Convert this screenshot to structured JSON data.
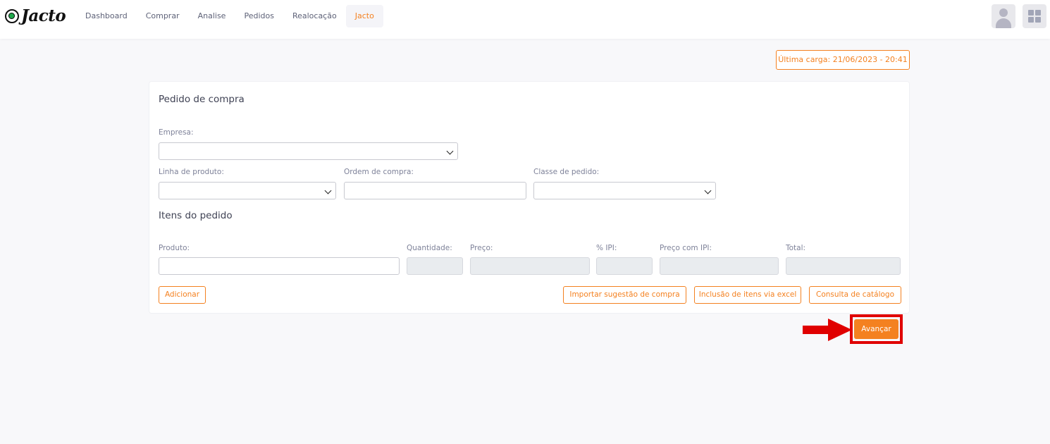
{
  "brand": {
    "name": "Jacto"
  },
  "nav": [
    {
      "label": "Dashboard",
      "active": false
    },
    {
      "label": "Comprar",
      "active": false
    },
    {
      "label": "Analise",
      "active": false
    },
    {
      "label": "Pedidos",
      "active": false
    },
    {
      "label": "Realocação",
      "active": false
    },
    {
      "label": "Jacto",
      "active": true
    }
  ],
  "header_icons": [
    "user-avatar-icon",
    "apps-grid-icon"
  ],
  "last_load": "Última carga: 21/06/2023 - 20:41",
  "order": {
    "title": "Pedido de compra",
    "empresa": {
      "label": "Empresa:",
      "value": ""
    },
    "linha_produto": {
      "label": "Linha de produto:",
      "value": ""
    },
    "ordem_compra": {
      "label": "Ordem de compra:",
      "value": ""
    },
    "classe_pedido": {
      "label": "Classe de pedido:",
      "value": ""
    }
  },
  "items": {
    "title": "Itens do pedido",
    "produto": {
      "label": "Produto:",
      "value": ""
    },
    "quantidade": {
      "label": "Quantidade:",
      "value": ""
    },
    "preco": {
      "label": "Preço:",
      "value": ""
    },
    "ipi": {
      "label": "% IPI:",
      "value": ""
    },
    "preco_ipi": {
      "label": "Preço com IPI:",
      "value": ""
    },
    "total": {
      "label": "Total:",
      "value": ""
    }
  },
  "buttons": {
    "adicionar": "Adicionar",
    "importar": "Importar sugestão de compra",
    "inclusao_excel": "Inclusão de itens via excel",
    "consulta_catalogo": "Consulta de catálogo",
    "avancar": "Avançar"
  },
  "colors": {
    "accent": "#f48120",
    "annotation": "#e00000",
    "logo_green": "#1fa84a"
  }
}
